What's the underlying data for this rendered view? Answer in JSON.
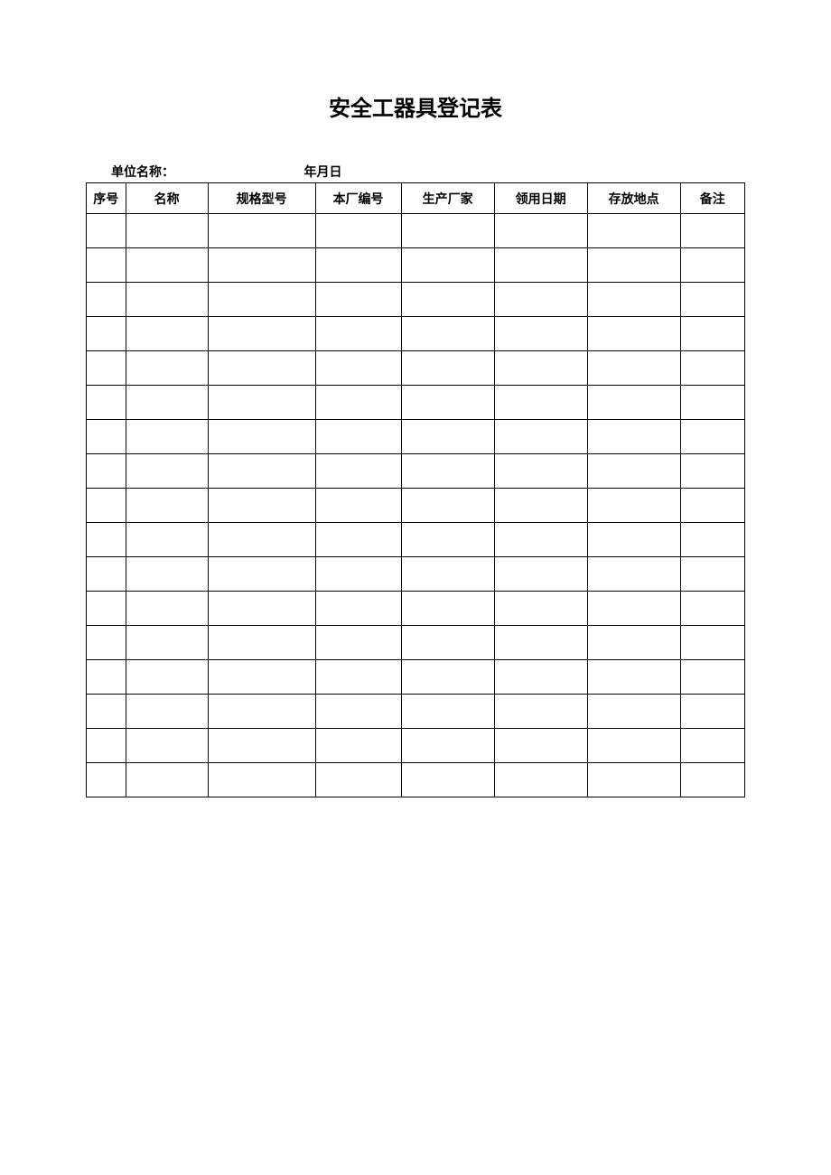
{
  "title": "安全工器具登记表",
  "meta": {
    "unit_label": "单位名称：",
    "date_label": "年月日"
  },
  "columns": [
    "序号",
    "名称",
    "规格型号",
    "本厂编号",
    "生产厂家",
    "领用日期",
    "存放地点",
    "备注"
  ],
  "rows": [
    {
      "seq": "",
      "name": "",
      "model": "",
      "fac_no": "",
      "mfr": "",
      "date": "",
      "loc": "",
      "note": ""
    },
    {
      "seq": "",
      "name": "",
      "model": "",
      "fac_no": "",
      "mfr": "",
      "date": "",
      "loc": "",
      "note": ""
    },
    {
      "seq": "",
      "name": "",
      "model": "",
      "fac_no": "",
      "mfr": "",
      "date": "",
      "loc": "",
      "note": ""
    },
    {
      "seq": "",
      "name": "",
      "model": "",
      "fac_no": "",
      "mfr": "",
      "date": "",
      "loc": "",
      "note": ""
    },
    {
      "seq": "",
      "name": "",
      "model": "",
      "fac_no": "",
      "mfr": "",
      "date": "",
      "loc": "",
      "note": ""
    },
    {
      "seq": "",
      "name": "",
      "model": "",
      "fac_no": "",
      "mfr": "",
      "date": "",
      "loc": "",
      "note": ""
    },
    {
      "seq": "",
      "name": "",
      "model": "",
      "fac_no": "",
      "mfr": "",
      "date": "",
      "loc": "",
      "note": ""
    },
    {
      "seq": "",
      "name": "",
      "model": "",
      "fac_no": "",
      "mfr": "",
      "date": "",
      "loc": "",
      "note": ""
    },
    {
      "seq": "",
      "name": "",
      "model": "",
      "fac_no": "",
      "mfr": "",
      "date": "",
      "loc": "",
      "note": ""
    },
    {
      "seq": "",
      "name": "",
      "model": "",
      "fac_no": "",
      "mfr": "",
      "date": "",
      "loc": "",
      "note": ""
    },
    {
      "seq": "",
      "name": "",
      "model": "",
      "fac_no": "",
      "mfr": "",
      "date": "",
      "loc": "",
      "note": ""
    },
    {
      "seq": "",
      "name": "",
      "model": "",
      "fac_no": "",
      "mfr": "",
      "date": "",
      "loc": "",
      "note": ""
    },
    {
      "seq": "",
      "name": "",
      "model": "",
      "fac_no": "",
      "mfr": "",
      "date": "",
      "loc": "",
      "note": ""
    },
    {
      "seq": "",
      "name": "",
      "model": "",
      "fac_no": "",
      "mfr": "",
      "date": "",
      "loc": "",
      "note": ""
    },
    {
      "seq": "",
      "name": "",
      "model": "",
      "fac_no": "",
      "mfr": "",
      "date": "",
      "loc": "",
      "note": ""
    },
    {
      "seq": "",
      "name": "",
      "model": "",
      "fac_no": "",
      "mfr": "",
      "date": "",
      "loc": "",
      "note": ""
    },
    {
      "seq": "",
      "name": "",
      "model": "",
      "fac_no": "",
      "mfr": "",
      "date": "",
      "loc": "",
      "note": ""
    }
  ]
}
